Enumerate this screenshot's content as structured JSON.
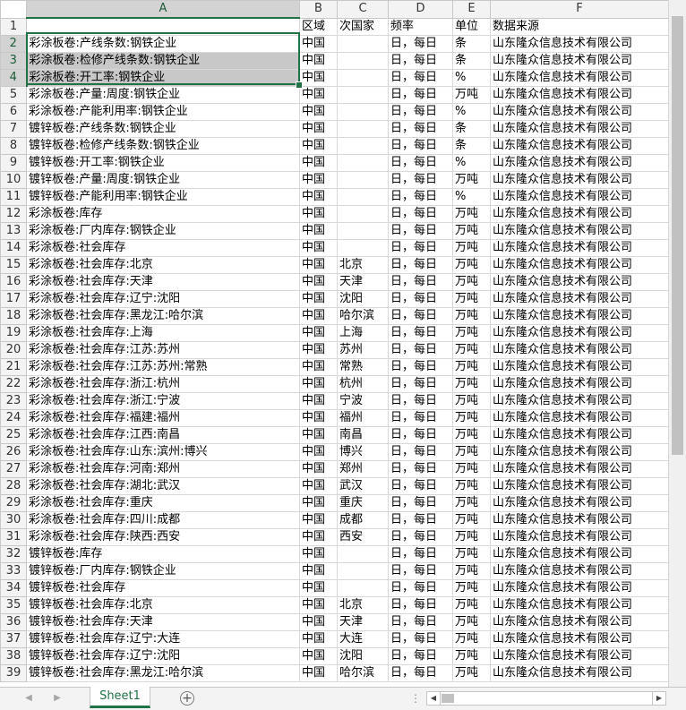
{
  "columns": [
    "A",
    "B",
    "C",
    "D",
    "E",
    "F"
  ],
  "header_row": {
    "num": "1",
    "cells": [
      "",
      "区域",
      "次国家",
      "频率",
      "单位",
      "数据来源"
    ]
  },
  "rows": [
    {
      "num": "2",
      "cells": [
        "彩涂板卷:产线条数:钢铁企业",
        "中国",
        "",
        "日，每日",
        "条",
        "山东隆众信息技术有限公司"
      ]
    },
    {
      "num": "3",
      "cells": [
        "彩涂板卷:检修产线条数:钢铁企业",
        "中国",
        "",
        "日，每日",
        "条",
        "山东隆众信息技术有限公司"
      ]
    },
    {
      "num": "4",
      "cells": [
        "彩涂板卷:开工率:钢铁企业",
        "中国",
        "",
        "日，每日",
        "%",
        "山东隆众信息技术有限公司"
      ]
    },
    {
      "num": "5",
      "cells": [
        "彩涂板卷:产量:周度:钢铁企业",
        "中国",
        "",
        "日，每日",
        "万吨",
        "山东隆众信息技术有限公司"
      ]
    },
    {
      "num": "6",
      "cells": [
        "彩涂板卷:产能利用率:钢铁企业",
        "中国",
        "",
        "日，每日",
        "%",
        "山东隆众信息技术有限公司"
      ]
    },
    {
      "num": "7",
      "cells": [
        "镀锌板卷:产线条数:钢铁企业",
        "中国",
        "",
        "日，每日",
        "条",
        "山东隆众信息技术有限公司"
      ]
    },
    {
      "num": "8",
      "cells": [
        "镀锌板卷:检修产线条数:钢铁企业",
        "中国",
        "",
        "日，每日",
        "条",
        "山东隆众信息技术有限公司"
      ]
    },
    {
      "num": "9",
      "cells": [
        "镀锌板卷:开工率:钢铁企业",
        "中国",
        "",
        "日，每日",
        "%",
        "山东隆众信息技术有限公司"
      ]
    },
    {
      "num": "10",
      "cells": [
        "镀锌板卷:产量:周度:钢铁企业",
        "中国",
        "",
        "日，每日",
        "万吨",
        "山东隆众信息技术有限公司"
      ]
    },
    {
      "num": "11",
      "cells": [
        "镀锌板卷:产能利用率:钢铁企业",
        "中国",
        "",
        "日，每日",
        "%",
        "山东隆众信息技术有限公司"
      ]
    },
    {
      "num": "12",
      "cells": [
        "彩涂板卷:库存",
        "中国",
        "",
        "日，每日",
        "万吨",
        "山东隆众信息技术有限公司"
      ]
    },
    {
      "num": "13",
      "cells": [
        "彩涂板卷:厂内库存:钢铁企业",
        "中国",
        "",
        "日，每日",
        "万吨",
        "山东隆众信息技术有限公司"
      ]
    },
    {
      "num": "14",
      "cells": [
        "彩涂板卷:社会库存",
        "中国",
        "",
        "日，每日",
        "万吨",
        "山东隆众信息技术有限公司"
      ]
    },
    {
      "num": "15",
      "cells": [
        "彩涂板卷:社会库存:北京",
        "中国",
        "北京",
        "日，每日",
        "万吨",
        "山东隆众信息技术有限公司"
      ]
    },
    {
      "num": "16",
      "cells": [
        "彩涂板卷:社会库存:天津",
        "中国",
        "天津",
        "日，每日",
        "万吨",
        "山东隆众信息技术有限公司"
      ]
    },
    {
      "num": "17",
      "cells": [
        "彩涂板卷:社会库存:辽宁:沈阳",
        "中国",
        "沈阳",
        "日，每日",
        "万吨",
        "山东隆众信息技术有限公司"
      ]
    },
    {
      "num": "18",
      "cells": [
        "彩涂板卷:社会库存:黑龙江:哈尔滨",
        "中国",
        "哈尔滨",
        "日，每日",
        "万吨",
        "山东隆众信息技术有限公司"
      ]
    },
    {
      "num": "19",
      "cells": [
        "彩涂板卷:社会库存:上海",
        "中国",
        "上海",
        "日，每日",
        "万吨",
        "山东隆众信息技术有限公司"
      ]
    },
    {
      "num": "20",
      "cells": [
        "彩涂板卷:社会库存:江苏:苏州",
        "中国",
        "苏州",
        "日，每日",
        "万吨",
        "山东隆众信息技术有限公司"
      ]
    },
    {
      "num": "21",
      "cells": [
        "彩涂板卷:社会库存:江苏:苏州:常熟",
        "中国",
        "常熟",
        "日，每日",
        "万吨",
        "山东隆众信息技术有限公司"
      ]
    },
    {
      "num": "22",
      "cells": [
        "彩涂板卷:社会库存:浙江:杭州",
        "中国",
        "杭州",
        "日，每日",
        "万吨",
        "山东隆众信息技术有限公司"
      ]
    },
    {
      "num": "23",
      "cells": [
        "彩涂板卷:社会库存:浙江:宁波",
        "中国",
        "宁波",
        "日，每日",
        "万吨",
        "山东隆众信息技术有限公司"
      ]
    },
    {
      "num": "24",
      "cells": [
        "彩涂板卷:社会库存:福建:福州",
        "中国",
        "福州",
        "日，每日",
        "万吨",
        "山东隆众信息技术有限公司"
      ]
    },
    {
      "num": "25",
      "cells": [
        "彩涂板卷:社会库存:江西:南昌",
        "中国",
        "南昌",
        "日，每日",
        "万吨",
        "山东隆众信息技术有限公司"
      ]
    },
    {
      "num": "26",
      "cells": [
        "彩涂板卷:社会库存:山东:滨州:博兴",
        "中国",
        "博兴",
        "日，每日",
        "万吨",
        "山东隆众信息技术有限公司"
      ]
    },
    {
      "num": "27",
      "cells": [
        "彩涂板卷:社会库存:河南:郑州",
        "中国",
        "郑州",
        "日，每日",
        "万吨",
        "山东隆众信息技术有限公司"
      ]
    },
    {
      "num": "28",
      "cells": [
        "彩涂板卷:社会库存:湖北:武汉",
        "中国",
        "武汉",
        "日，每日",
        "万吨",
        "山东隆众信息技术有限公司"
      ]
    },
    {
      "num": "29",
      "cells": [
        "彩涂板卷:社会库存:重庆",
        "中国",
        "重庆",
        "日，每日",
        "万吨",
        "山东隆众信息技术有限公司"
      ]
    },
    {
      "num": "30",
      "cells": [
        "彩涂板卷:社会库存:四川:成都",
        "中国",
        "成都",
        "日，每日",
        "万吨",
        "山东隆众信息技术有限公司"
      ]
    },
    {
      "num": "31",
      "cells": [
        "彩涂板卷:社会库存:陕西:西安",
        "中国",
        "西安",
        "日，每日",
        "万吨",
        "山东隆众信息技术有限公司"
      ]
    },
    {
      "num": "32",
      "cells": [
        "镀锌板卷:库存",
        "中国",
        "",
        "日，每日",
        "万吨",
        "山东隆众信息技术有限公司"
      ]
    },
    {
      "num": "33",
      "cells": [
        "镀锌板卷:厂内库存:钢铁企业",
        "中国",
        "",
        "日，每日",
        "万吨",
        "山东隆众信息技术有限公司"
      ]
    },
    {
      "num": "34",
      "cells": [
        "镀锌板卷:社会库存",
        "中国",
        "",
        "日，每日",
        "万吨",
        "山东隆众信息技术有限公司"
      ]
    },
    {
      "num": "35",
      "cells": [
        "镀锌板卷:社会库存:北京",
        "中国",
        "北京",
        "日，每日",
        "万吨",
        "山东隆众信息技术有限公司"
      ]
    },
    {
      "num": "36",
      "cells": [
        "镀锌板卷:社会库存:天津",
        "中国",
        "天津",
        "日，每日",
        "万吨",
        "山东隆众信息技术有限公司"
      ]
    },
    {
      "num": "37",
      "cells": [
        "镀锌板卷:社会库存:辽宁:大连",
        "中国",
        "大连",
        "日，每日",
        "万吨",
        "山东隆众信息技术有限公司"
      ]
    },
    {
      "num": "38",
      "cells": [
        "镀锌板卷:社会库存:辽宁:沈阳",
        "中国",
        "沈阳",
        "日，每日",
        "万吨",
        "山东隆众信息技术有限公司"
      ]
    },
    {
      "num": "39",
      "cells": [
        "镀锌板卷:社会库存:黑龙江:哈尔滨",
        "中国",
        "哈尔滨",
        "日，每日",
        "万吨",
        "山东隆众信息技术有限公司"
      ]
    }
  ],
  "selection": {
    "start_row": "2",
    "end_row": "4",
    "column": "A"
  },
  "sheet_tabs": [
    {
      "label": "Sheet1",
      "active": true
    }
  ],
  "icons": {
    "prev_sheet": "triangle-left-icon",
    "next_sheet": "triangle-right-icon",
    "add_sheet": "plus-circle-icon",
    "scroll_left": "triangle-left-icon",
    "scroll_right": "triangle-right-icon"
  },
  "colors": {
    "accent": "#217346",
    "selected_fill": "#c8c8c8",
    "header_fill": "#f3f3f3",
    "gridline": "#d9d9d9"
  }
}
